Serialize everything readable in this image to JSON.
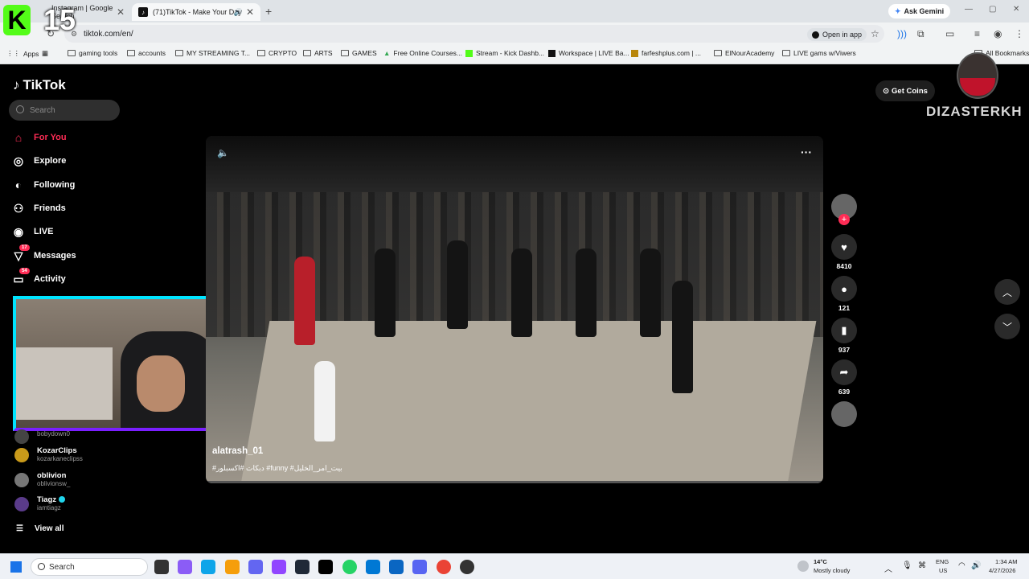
{
  "browser": {
    "tabs": [
      {
        "label": "Instagram | Google Search"
      },
      {
        "label": "(71)TikTok - Make Your Day"
      }
    ],
    "ask_gemini": "Ask Gemini",
    "url": "tiktok.com/en/",
    "open_in_app": "Open in app",
    "bookmarks": [
      "Apps",
      "gaming tools",
      "accounts",
      "MY STREAMING T...",
      "CRYPTO",
      "ARTS",
      "GAMES",
      "Free Online Courses...",
      "Stream - Kick Dashb...",
      "Workspace | LIVE Ba...",
      "farfeshplus.com | ...",
      "ElNourAcademy",
      "LIVE gams w/Viwers",
      "All Bookmarks"
    ]
  },
  "overlay": {
    "kick_letter": "K",
    "counter": "15"
  },
  "sidebar": {
    "logo": "TikTok",
    "search_placeholder": "Search",
    "nav": [
      {
        "label": "For You",
        "icon": "home-icon"
      },
      {
        "label": "Explore",
        "icon": "compass-icon"
      },
      {
        "label": "Following",
        "icon": "following-icon"
      },
      {
        "label": "Friends",
        "icon": "friends-icon"
      },
      {
        "label": "LIVE",
        "icon": "live-icon"
      },
      {
        "label": "Messages",
        "icon": "messages-icon",
        "badge": "17"
      },
      {
        "label": "Activity",
        "icon": "activity-icon",
        "badge": "54"
      }
    ],
    "following": [
      {
        "name": "",
        "handle": "bobydown0"
      },
      {
        "name": "KozarClips",
        "handle": "kozarkaneclipss"
      },
      {
        "name": "oblivion",
        "handle": "oblivionsw_"
      },
      {
        "name": "Tiagz",
        "handle": "iamtiagz",
        "verified": true
      }
    ],
    "view_all": "View all"
  },
  "video": {
    "author": "alatrash_01",
    "caption": "#دبكات #اكسبلور #funny #بيت_امر_الخليل"
  },
  "actions": {
    "likes": "8410",
    "comments": "121",
    "saves": "937",
    "shares": "639"
  },
  "header": {
    "get_coins": "Get Coins",
    "brand": "DIZASTERKH"
  },
  "taskbar": {
    "search": "Search",
    "weather_temp": "14°C",
    "weather_desc": "Mostly cloudy",
    "lang": "ENG",
    "region": "US",
    "time": "1:34 AM",
    "date": "4/27/2026"
  }
}
